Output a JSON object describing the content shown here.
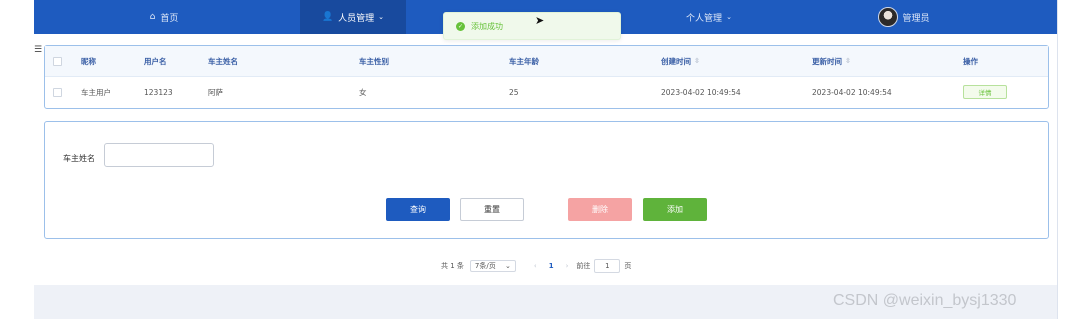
{
  "nav": {
    "home_label": "首页",
    "staff_label": "人员管理",
    "profile_label": "个人管理",
    "user_label": "管理员",
    "bg_color": "#1e5bbf"
  },
  "toast": {
    "message": "添加成功",
    "type": "success"
  },
  "table": {
    "columns": [
      "昵称",
      "用户名",
      "车主姓名",
      "车主性别",
      "车主年龄",
      "创建时间",
      "更新时间",
      "操作"
    ],
    "rows": [
      {
        "nickname": "车主用户",
        "username": "123123",
        "owner_name": "阿萨",
        "gender": "女",
        "age": "25",
        "created": "2023-04-02 10:49:54",
        "updated": "2023-04-02 10:49:54",
        "action": "详情"
      }
    ]
  },
  "form": {
    "owner_name_label": "车主姓名",
    "owner_name_value": "",
    "query_label": "查询",
    "reset_label": "重置",
    "delete_label": "删除",
    "add_label": "添加"
  },
  "pagination": {
    "total": "共 1 条",
    "page_size": "7条/页",
    "current_page": "1",
    "goto_label": "前往",
    "goto_value": "1",
    "page_suffix": "页"
  },
  "watermark": "CSDN @weixin_bysj1330"
}
